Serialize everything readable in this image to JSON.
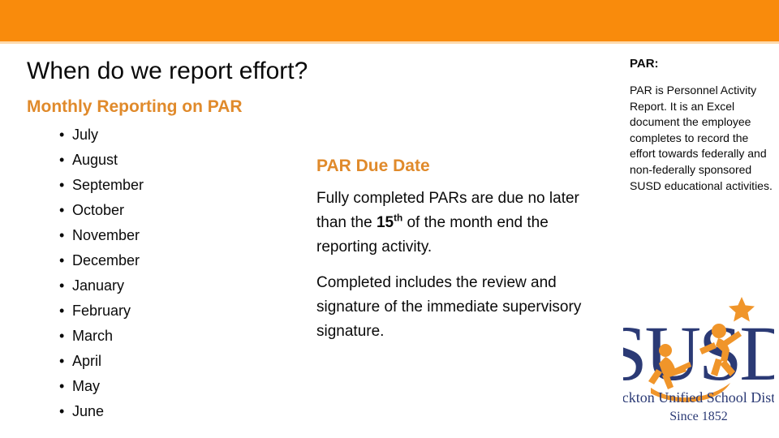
{
  "slide": {
    "title": "When do we report effort?",
    "subtitle": "Monthly Reporting on PAR"
  },
  "theme": {
    "banner_color": "#f98b0c",
    "accent_orange": "#e08a2b",
    "logo_navy": "#2b3a75",
    "logo_orange": "#f0952a",
    "text_black": "#0a0a0a"
  },
  "months": [
    {
      "label": "July"
    },
    {
      "label": "August"
    },
    {
      "label": "September"
    },
    {
      "label": "October"
    },
    {
      "label": "November"
    },
    {
      "label": "December"
    },
    {
      "label": "January"
    },
    {
      "label": "February"
    },
    {
      "label": "March"
    },
    {
      "label": "April"
    },
    {
      "label": "May"
    },
    {
      "label": "June"
    }
  ],
  "bullet_glyph": "•",
  "due_date": {
    "heading": "PAR Due Date",
    "paragraph_1_before": "Fully completed PARs are due no later than the ",
    "paragraph_1_bold": "15",
    "paragraph_1_sup": "th",
    "paragraph_1_after": " of the month end the reporting activity.",
    "paragraph_2": "Completed includes the review and signature of the immediate supervisory signature."
  },
  "sidebar": {
    "heading": "PAR:",
    "paragraph": "PAR is Personnel Activity Report. It is an Excel document the employee completes to record the effort towards federally and non-federally sponsored SUSD educational activities."
  },
  "logo": {
    "acronym": "SUSD",
    "name": "Stockton Unified School District",
    "tagline": "Since 1852"
  }
}
